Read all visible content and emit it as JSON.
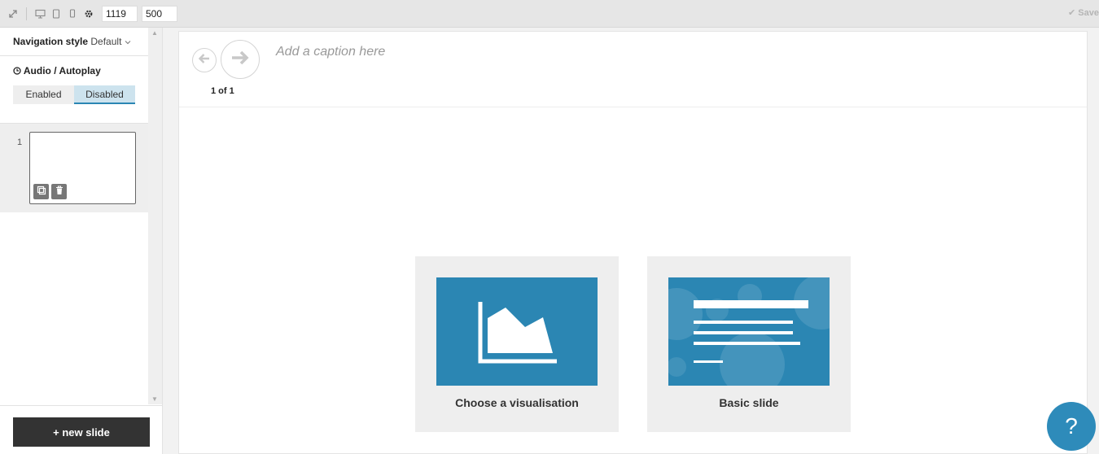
{
  "toolbar": {
    "icons": [
      "expand-icon",
      "desktop-icon",
      "tablet-icon",
      "mobile-icon",
      "gear-icon"
    ],
    "width_value": "1119",
    "height_value": "500",
    "save_label": "Save"
  },
  "sidebar": {
    "navigation_style_label": "Navigation style",
    "navigation_style_value": "Default",
    "audio_title": "Audio / Autoplay",
    "autoplay_options": [
      "Enabled",
      "Disabled"
    ],
    "autoplay_selected": "Disabled",
    "slides": [
      {
        "number": "1"
      }
    ],
    "new_slide_label": "+ new slide"
  },
  "main": {
    "caption_placeholder": "Add a caption here",
    "page_indicator": "1 of 1",
    "options": [
      {
        "label": "Choose a visualisation",
        "icon": "area-chart-icon"
      },
      {
        "label": "Basic slide",
        "icon": "text-lines-icon"
      }
    ]
  },
  "help": {
    "label": "?"
  },
  "colors": {
    "accent": "#2b86b3",
    "toolbar_bg": "#e6e6e6",
    "button_dark": "#333333"
  }
}
